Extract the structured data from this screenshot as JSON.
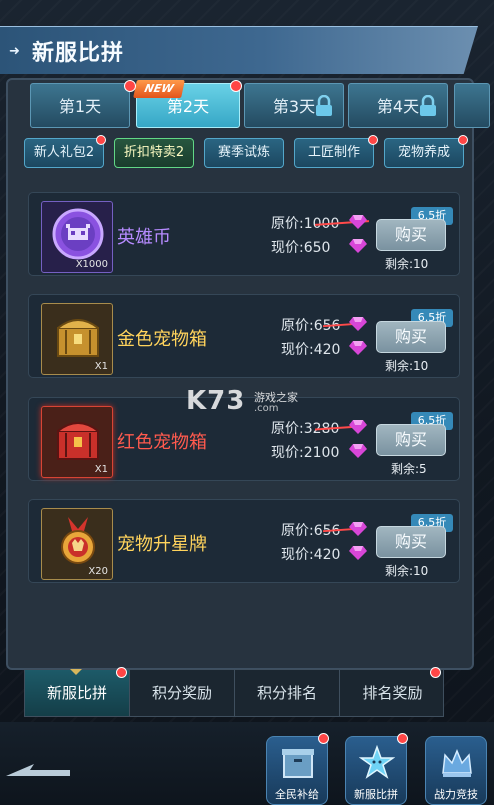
{
  "header": {
    "title": "新服比拼"
  },
  "day_tabs": [
    {
      "label": "第1天",
      "locked": false
    },
    {
      "label": "第2天",
      "locked": false,
      "badge": "NEW"
    },
    {
      "label": "第3天",
      "locked": true
    },
    {
      "label": "第4天",
      "locked": true
    }
  ],
  "sub_tabs": [
    "新人礼包2",
    "折扣特卖2",
    "赛季试炼",
    "工匠制作",
    "宠物养成"
  ],
  "items": [
    {
      "name": "英雄币",
      "name_color": "#b68bff",
      "qty": "X1000",
      "orig_label": "原价:1000",
      "now_label": "现价:650",
      "discount": "6.5折",
      "buy": "购买",
      "remain": "剩余:10"
    },
    {
      "name": "金色宠物箱",
      "name_color": "#ffd35c",
      "qty": "X1",
      "orig_label": "原价:656",
      "now_label": "现价:420",
      "discount": "6.5折",
      "buy": "购买",
      "remain": "剩余:10"
    },
    {
      "name": "红色宠物箱",
      "name_color": "#ff5a4e",
      "qty": "X1",
      "orig_label": "原价:3280",
      "now_label": "现价:2100",
      "discount": "6.5折",
      "buy": "购买",
      "remain": "剩余:5"
    },
    {
      "name": "宠物升星牌",
      "name_color": "#ffd35c",
      "qty": "X20",
      "orig_label": "原价:656",
      "now_label": "现价:420",
      "discount": "6.5折",
      "buy": "购买",
      "remain": "剩余:10"
    }
  ],
  "bottom_tabs": [
    "新服比拼",
    "积分奖励",
    "积分排名",
    "排名奖励"
  ],
  "footer_buttons": [
    "全民补给",
    "新服比拼",
    "战力竞技"
  ],
  "watermark": {
    "logo": "K73",
    "sub": "游戏之家",
    "url": ".com"
  },
  "colors": {
    "gem": "#d846d8",
    "accent": "#36a7c6",
    "notify": "#ff4646"
  }
}
